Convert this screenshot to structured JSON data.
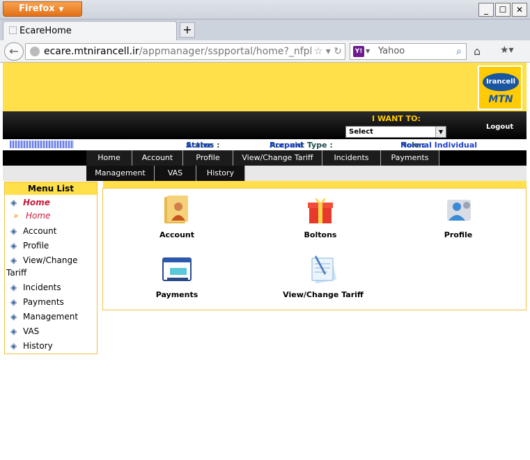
{
  "browser": {
    "app_button": "Firefox",
    "tab_title": "EcareHome",
    "url_host": "ecare.mtnirancell.ir",
    "url_path": "/appmanager/sspportal/home?_nfpb=tru",
    "search_engine": "Yahoo",
    "window_controls": [
      "_",
      "☐",
      "✕"
    ]
  },
  "header": {
    "logo_top": "Irancell",
    "logo_bottom": "MTN",
    "i_want_to": "I WANT TO:",
    "select_value": "Select",
    "logout": "Logout"
  },
  "info": {
    "welcome_label": "Welcome",
    "status_label": "Status :",
    "status_value": "Active",
    "account_type_label": "Account Type :",
    "account_type_value": "Prepaid",
    "role_label": "Role :",
    "role_value": "Normal Individual"
  },
  "menu": {
    "row1": [
      "Home",
      "Account",
      "Profile",
      "View/Change Tariff",
      "Incidents",
      "Payments"
    ],
    "row2": [
      "Management",
      "VAS",
      "History"
    ]
  },
  "sidebar": {
    "title": "Menu List",
    "home_head": "Home",
    "home_sub": "Home",
    "items": [
      "Account",
      "Profile",
      "View/Change",
      "Tariff",
      "Incidents",
      "Payments",
      "Management",
      "VAS",
      "History"
    ]
  },
  "tiles": [
    "Account",
    "Boltons",
    "Profile",
    "Payments",
    "View/Change Tariff"
  ]
}
